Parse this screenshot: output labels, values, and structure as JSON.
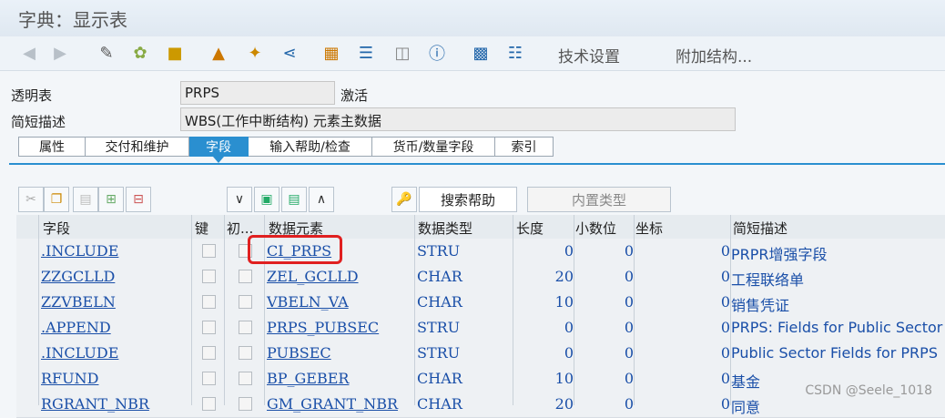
{
  "title": "字典：显示表",
  "toolbar": {
    "tech_settings": "技术设置",
    "append_structure": "附加结构..."
  },
  "header": {
    "transparent_table_label": "透明表",
    "table_name": "PRPS",
    "status": "激活",
    "short_desc_label": "简短描述",
    "short_desc": "WBS(工作中断结构) 元素主数据"
  },
  "tabs": [
    "属性",
    "交付和维护",
    "字段",
    "输入帮助/检查",
    "货币/数量字段",
    "索引"
  ],
  "active_tab": "字段",
  "buttons": {
    "search_help": "搜索帮助",
    "builtin_type": "内置类型"
  },
  "columns": [
    "字段",
    "键",
    "初...",
    "数据元素",
    "数据类型",
    "长度",
    "小数位",
    "坐标",
    "简短描述"
  ],
  "rows": [
    {
      "field": ".INCLUDE",
      "element": "CI_PRPS",
      "type": "STRU",
      "length": "0",
      "decimals": "0",
      "coord": "0",
      "desc": "PRPR增强字段"
    },
    {
      "field": "ZZGCLLD",
      "element": "ZEL_GCLLD",
      "type": "CHAR",
      "length": "20",
      "decimals": "0",
      "coord": "0",
      "desc": "工程联络单"
    },
    {
      "field": "ZZVBELN",
      "element": "VBELN_VA",
      "type": "CHAR",
      "length": "10",
      "decimals": "0",
      "coord": "0",
      "desc": "销售凭证"
    },
    {
      "field": ".APPEND",
      "element": "PRPS_PUBSEC",
      "type": "STRU",
      "length": "0",
      "decimals": "0",
      "coord": "0",
      "desc": "PRPS: Fields for Public Sector"
    },
    {
      "field": ".INCLUDE",
      "element": "PUBSEC",
      "type": "STRU",
      "length": "0",
      "decimals": "0",
      "coord": "0",
      "desc": "Public Sector Fields for PRPS"
    },
    {
      "field": "RFUND",
      "element": "BP_GEBER",
      "type": "CHAR",
      "length": "10",
      "decimals": "0",
      "coord": "0",
      "desc": "基金"
    },
    {
      "field": "RGRANT_NBR",
      "element": "GM_GRANT_NBR",
      "type": "CHAR",
      "length": "20",
      "decimals": "0",
      "coord": "0",
      "desc": "同意"
    }
  ],
  "watermark": "CSDN @Seele_1018"
}
